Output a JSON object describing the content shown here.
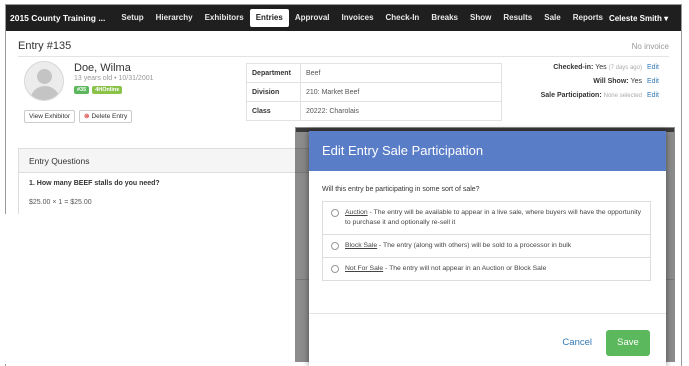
{
  "nav": {
    "brand": "2015 County Training ...",
    "items": [
      "Setup",
      "Hierarchy",
      "Exhibitors",
      "Entries",
      "Approval",
      "Invoices",
      "Check-In",
      "Breaks",
      "Show",
      "Results",
      "Sale",
      "Reports"
    ],
    "active": "Entries",
    "user": "Celeste Smith"
  },
  "entry": {
    "title": "Entry #135",
    "invoice_status": "No invoice",
    "exhibitor_name": "Doe, Wilma",
    "exhibitor_age": "13 years old • 10/31/2001",
    "badge_number": "#35",
    "badge_online": "4HOnline",
    "view_exhibitor_label": "View Exhibitor",
    "delete_entry_label": "Delete Entry"
  },
  "details": [
    {
      "label": "Department",
      "value": "Beef"
    },
    {
      "label": "Division",
      "value": "210: Market Beef"
    },
    {
      "label": "Class",
      "value": "20222: Charolais"
    }
  ],
  "status": {
    "checked_in_label": "Checked-in:",
    "checked_in_value": "Yes",
    "checked_in_hint": "(7 days ago)",
    "will_show_label": "Will Show:",
    "will_show_value": "Yes",
    "sale_label": "Sale Participation:",
    "sale_hint": "None selected",
    "edit_label": "Edit"
  },
  "questions": {
    "header": "Entry Questions",
    "q1": "1. How many BEEF stalls do you need?",
    "q1_answer": "$25.00 × 1 = $25.00"
  },
  "modal": {
    "title": "Edit Entry Sale Participation",
    "question": "Will this entry be participating in some sort of sale?",
    "options": [
      {
        "name": "Auction",
        "desc": " - The entry will be available to appear in a live sale, where buyers will have the opportunity to purchase it and optionally re-sell it"
      },
      {
        "name": "Block Sale",
        "desc": " - The entry (along with others) will be sold to a processor in bulk"
      },
      {
        "name": "Not For Sale",
        "desc": " - The entry will not appear in an Auction or Block Sale"
      }
    ],
    "cancel_label": "Cancel",
    "save_label": "Save"
  },
  "colors": {
    "navbar": "#1f1f1f",
    "modal_header": "#5a7dc8",
    "save_button": "#5cb85c",
    "link": "#337ab7"
  }
}
